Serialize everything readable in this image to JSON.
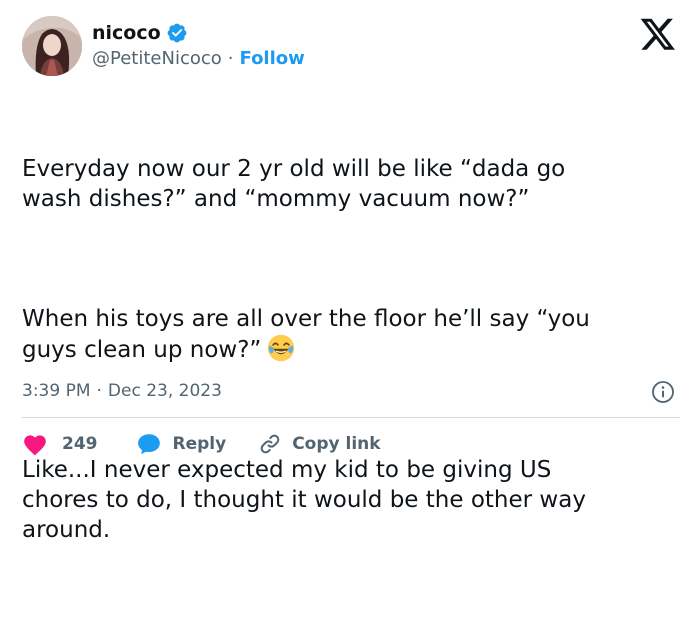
{
  "author": {
    "display_name": "nicoco",
    "handle": "@PetiteNicoco",
    "separator": "·",
    "follow_label": "Follow",
    "verified_color": "#1d9bf0"
  },
  "tweet": {
    "paragraph_1": "Everyday now our 2 yr old will be like “dada go\nwash dishes?” and “mommy vacuum now?”",
    "paragraph_2": "When his toys are all over the floor he’ll say “you\nguys clean up now?”",
    "paragraph_2_emoji": "face-with-tears-of-joy",
    "paragraph_3": "Like...I never expected my kid to be giving US\nchores to do, I thought it would be the other way\naround."
  },
  "meta": {
    "time": "3:39 PM",
    "separator": "·",
    "date": "Dec 23, 2023"
  },
  "actions": {
    "like_count": "249",
    "reply_label": "Reply",
    "copy_link_label": "Copy link",
    "like_color": "#f91880",
    "reply_color": "#1d9bf0"
  },
  "icons": {
    "brand": "x-logo-icon",
    "info": "info-icon",
    "like": "heart-icon",
    "reply": "speech-bubble-icon",
    "copy": "link-icon"
  }
}
